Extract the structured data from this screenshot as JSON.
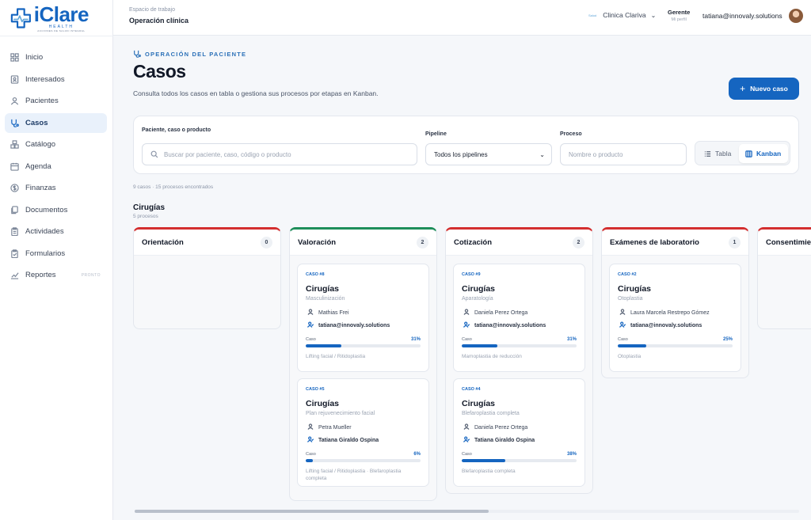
{
  "brand": {
    "name": "iClare",
    "sub": "HEALTH",
    "tagline": "ACCIONES DE SALUD INTEGRAL"
  },
  "sidebar": {
    "items": [
      {
        "label": "Inicio",
        "icon": "grid-icon"
      },
      {
        "label": "Interesados",
        "icon": "contact-icon"
      },
      {
        "label": "Pacientes",
        "icon": "user-icon"
      },
      {
        "label": "Casos",
        "icon": "stethoscope-icon",
        "active": true
      },
      {
        "label": "Catálogo",
        "icon": "boxes-icon"
      },
      {
        "label": "Agenda",
        "icon": "calendar-icon"
      },
      {
        "label": "Finanzas",
        "icon": "dollar-icon"
      },
      {
        "label": "Documentos",
        "icon": "documents-icon"
      },
      {
        "label": "Actividades",
        "icon": "clipboard-icon"
      },
      {
        "label": "Formularios",
        "icon": "form-icon"
      },
      {
        "label": "Reportes",
        "icon": "chart-icon",
        "badge": "PRONTO"
      }
    ]
  },
  "topbar": {
    "workspace_label": "Espacio de trabajo",
    "workspace_title": "Operación clínica",
    "clinic_mini": "Salud",
    "clinic_name": "Clinica Clariva",
    "role": "Gerente",
    "profile_link": "Mi perfil",
    "user_email": "tatiana@innovaly.solutions"
  },
  "header": {
    "eyebrow": "OPERACIÓN DEL PACIENTE",
    "title": "Casos",
    "description": "Consulta todos los casos en tabla o gestiona sus procesos por etapas en Kanban.",
    "new_button": "Nuevo caso"
  },
  "filters": {
    "search_label": "Paciente, caso o producto",
    "search_placeholder": "Buscar por paciente, caso, código o producto",
    "pipeline_label": "Pipeline",
    "pipeline_value": "Todos los pipelines",
    "process_label": "Proceso",
    "process_placeholder": "Nombre o producto",
    "view_table": "Tabla",
    "view_kanban": "Kanban"
  },
  "summary": "9 casos · 15 procesos encontrados",
  "group": {
    "title": "Cirugías",
    "subtitle": "5 procesos"
  },
  "progress_label": "Caso",
  "columns": [
    {
      "name": "Orientación",
      "count": "0",
      "accent": "#d32f2f",
      "cards": []
    },
    {
      "name": "Valoración",
      "count": "2",
      "accent": "#1e8e5a",
      "cards": [
        {
          "id": "CASO #8",
          "title": "Cirugías",
          "subtitle": "Masculinización",
          "patient": "Mathias Frei",
          "owner": "tatiana@innovaly.solutions",
          "progress": 31,
          "progress_text": "31%",
          "footer": "Lifting facial / Ritidoplastia"
        },
        {
          "id": "CASO #5",
          "title": "Cirugías",
          "subtitle": "Plan rejuvenecimiento facial",
          "patient": "Petra Mueller",
          "owner": "Tatiana Giraldo Ospina",
          "progress": 6,
          "progress_text": "6%",
          "footer": "Lifting facial / Ritidoplastia · Blefaroplastia completa"
        }
      ]
    },
    {
      "name": "Cotización",
      "count": "2",
      "accent": "#d32f2f",
      "cards": [
        {
          "id": "CASO #9",
          "title": "Cirugías",
          "subtitle": "Aparatología",
          "patient": "Daniela Perez Ortega",
          "owner": "tatiana@innovaly.solutions",
          "progress": 31,
          "progress_text": "31%",
          "footer": "Mamoplastia de reducción"
        },
        {
          "id": "CASO #4",
          "title": "Cirugías",
          "subtitle": "Blefaroplastia completa",
          "patient": "Daniela Perez Ortega",
          "owner": "Tatiana Giraldo Ospina",
          "progress": 38,
          "progress_text": "38%",
          "footer": "Blefaroplastia completa"
        }
      ]
    },
    {
      "name": "Exámenes de laboratorio",
      "count": "1",
      "accent": "#d32f2f",
      "cards": [
        {
          "id": "CASO #2",
          "title": "Cirugías",
          "subtitle": "Otoplastia",
          "patient": "Laura Marcela Restrepo Gómez",
          "owner": "tatiana@innovaly.solutions",
          "progress": 25,
          "progress_text": "25%",
          "footer": "Otoplastia"
        }
      ]
    },
    {
      "name": "Consentimiento",
      "count": "",
      "accent": "#d32f2f",
      "cards": []
    }
  ]
}
